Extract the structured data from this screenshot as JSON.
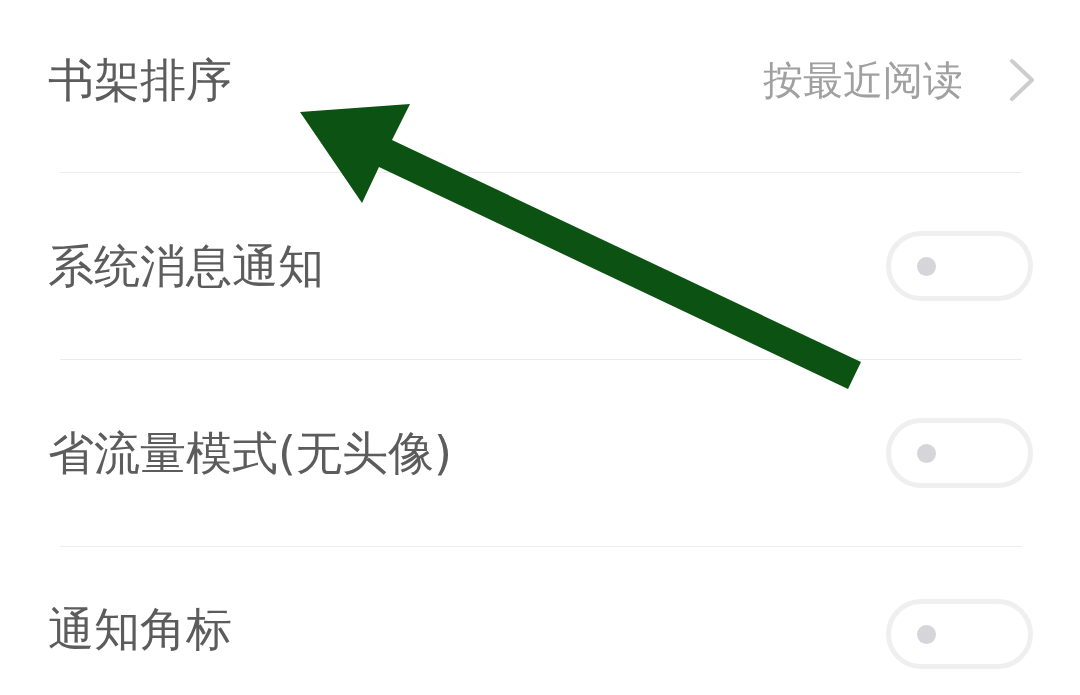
{
  "settings": [
    {
      "kind": "link",
      "label": "书架排序",
      "value": "按最近阅读"
    },
    {
      "kind": "toggle",
      "label": "系统消息通知",
      "on": false
    },
    {
      "kind": "toggle",
      "label": "省流量模式(无头像)",
      "on": false
    },
    {
      "kind": "toggle",
      "label": "通知角标",
      "on": false
    }
  ]
}
